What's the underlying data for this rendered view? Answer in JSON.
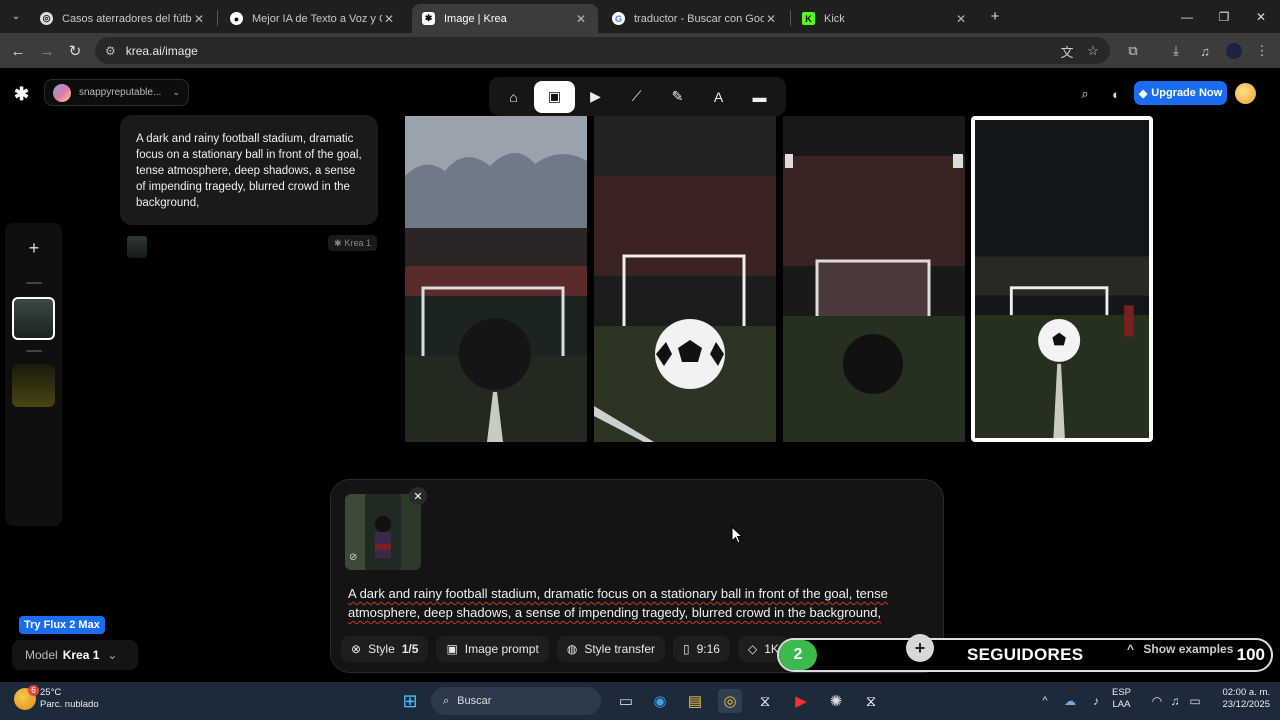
{
  "browser": {
    "tabs": [
      {
        "title": "Casos aterradores del fútbol",
        "icon": "web-icon",
        "active": false
      },
      {
        "title": "Mejor IA de Texto a Voz y Clon",
        "icon": "voice-icon",
        "active": false
      },
      {
        "title": "Image | Krea",
        "icon": "krea-icon",
        "active": true
      },
      {
        "title": "traductor - Buscar con Google",
        "icon": "google-icon",
        "active": false
      },
      {
        "title": "Kick",
        "icon": "kick-icon",
        "active": false
      }
    ],
    "url": "krea.ai/image"
  },
  "header": {
    "username": "snappyreputable...",
    "upgrade_label": "Upgrade Now",
    "tools": [
      "home-icon",
      "image-icon",
      "video-icon",
      "enhance-icon",
      "edit-icon",
      "font-icon",
      "folder-icon"
    ]
  },
  "history": {
    "prompt": "A dark and rainy football stadium, dramatic focus on a stationary ball in front of the goal, tense atmosphere, deep shadows, a sense of impending tragedy, blurred crowd in the background,",
    "model_tag": "Krea 1"
  },
  "composer": {
    "prompt": "A dark and rainy football stadium, dramatic focus on a stationary ball in front of the goal, tense atmosphere, deep shadows, a sense of impending tragedy, blurred crowd in the background,",
    "style_label": "Style",
    "style_count": "1/5",
    "image_prompt_label": "Image prompt",
    "style_transfer_label": "Style transfer",
    "aspect": "9:16",
    "resolution": "1K"
  },
  "sidebar": {
    "try_label": "Try Flux 2 Max",
    "model_label": "Model",
    "model_value": "Krea 1"
  },
  "overlay": {
    "count": "2",
    "label": "SEGUIDORES",
    "show_examples": "Show examples",
    "goal": "100"
  },
  "taskbar": {
    "temp": "25°C",
    "weather": "Parc. nublado",
    "weather_badge": "6",
    "search_label": "Buscar",
    "lang1": "ESP",
    "lang2": "LAA",
    "time": "02:00 a. m.",
    "date": "23/12/2025"
  }
}
